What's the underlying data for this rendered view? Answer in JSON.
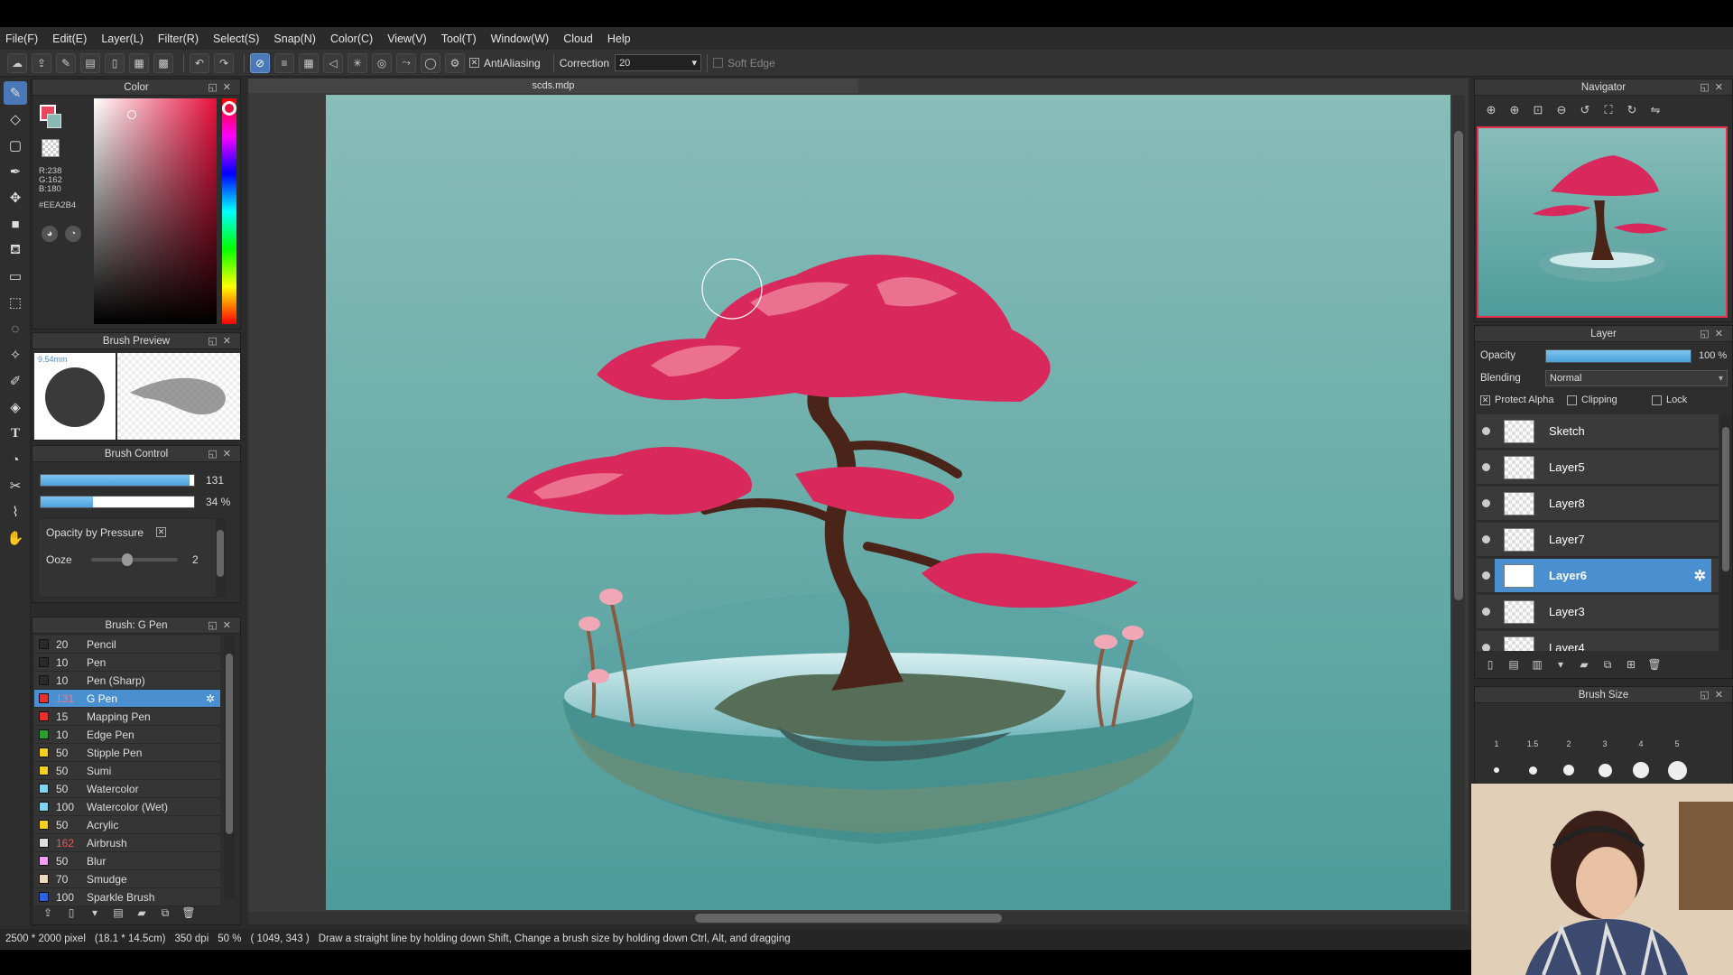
{
  "menu": [
    "File(F)",
    "Edit(E)",
    "Layer(L)",
    "Filter(R)",
    "Select(S)",
    "Snap(N)",
    "Color(C)",
    "View(V)",
    "Tool(T)",
    "Window(W)",
    "Cloud",
    "Help"
  ],
  "toolbar": {
    "antialiasing_label": "AntiAliasing",
    "correction_label": "Correction",
    "correction_value": "20",
    "soft_edge_label": "Soft Edge"
  },
  "color_panel": {
    "title": "Color",
    "r": "R:238",
    "g": "G:162",
    "b": "B:180",
    "hex": "#EEA2B4",
    "foreground": "#EEA2B4"
  },
  "brush_preview": {
    "title": "Brush Preview",
    "size_label": "9.54mm"
  },
  "brush_control": {
    "title": "Brush Control",
    "size_value": "131",
    "size_fraction": 0.97,
    "opacity_value": "34 %",
    "opacity_fraction": 0.34,
    "opacity_by_pressure_label": "Opacity by Pressure",
    "ooze_label": "Ooze",
    "ooze_value": "2"
  },
  "brush_list": {
    "title": "Brush: G Pen",
    "items": [
      {
        "size": "20",
        "name": "Pencil",
        "color": "#2a2a2a"
      },
      {
        "size": "10",
        "name": "Pen",
        "color": "#2a2a2a"
      },
      {
        "size": "10",
        "name": "Pen (Sharp)",
        "color": "#2a2a2a"
      },
      {
        "size": "131",
        "name": "G Pen",
        "color": "#e53030",
        "selected": true
      },
      {
        "size": "15",
        "name": "Mapping Pen",
        "color": "#e53030"
      },
      {
        "size": "10",
        "name": "Edge Pen",
        "color": "#2ca02c"
      },
      {
        "size": "50",
        "name": "Stipple Pen",
        "color": "#f0d020"
      },
      {
        "size": "50",
        "name": "Sumi",
        "color": "#f0d020"
      },
      {
        "size": "50",
        "name": "Watercolor",
        "color": "#7fd4f0"
      },
      {
        "size": "100",
        "name": "Watercolor (Wet)",
        "color": "#7fd4f0"
      },
      {
        "size": "50",
        "name": "Acrylic",
        "color": "#f0d020"
      },
      {
        "size": "162",
        "name": "Airbrush",
        "color": "#dddddd",
        "size_color": "#e05a5a"
      },
      {
        "size": "50",
        "name": "Blur",
        "color": "#f0a0f0"
      },
      {
        "size": "70",
        "name": "Smudge",
        "color": "#f0d8c0"
      },
      {
        "size": "100",
        "name": "Sparkle Brush",
        "color": "#3060e0"
      }
    ]
  },
  "document": {
    "tab_title": "scds.mdp"
  },
  "navigator": {
    "title": "Navigator"
  },
  "layer_panel": {
    "title": "Layer",
    "opacity_label": "Opacity",
    "opacity_value": "100 %",
    "opacity_fraction": 1.0,
    "blending_label": "Blending",
    "blending_value": "Normal",
    "protect_alpha_label": "Protect Alpha",
    "clipping_label": "Clipping",
    "lock_label": "Lock",
    "layers": [
      {
        "name": "Sketch"
      },
      {
        "name": "Layer5"
      },
      {
        "name": "Layer8"
      },
      {
        "name": "Layer7"
      },
      {
        "name": "Layer6",
        "selected": true
      },
      {
        "name": "Layer3"
      },
      {
        "name": "Layer4"
      }
    ]
  },
  "brush_size": {
    "title": "Brush Size",
    "labels": [
      "1",
      "1.5",
      "2",
      "3",
      "4",
      "5"
    ]
  },
  "status": {
    "dimensions": "2500 * 2000 pixel",
    "physical": "(18.1 * 14.5cm)",
    "dpi": "350 dpi",
    "zoom": "50 %",
    "cursor": "( 1049, 343 )",
    "hint": "Draw a straight line by holding down Shift, Change a brush size by holding down Ctrl, Alt, and dragging"
  }
}
